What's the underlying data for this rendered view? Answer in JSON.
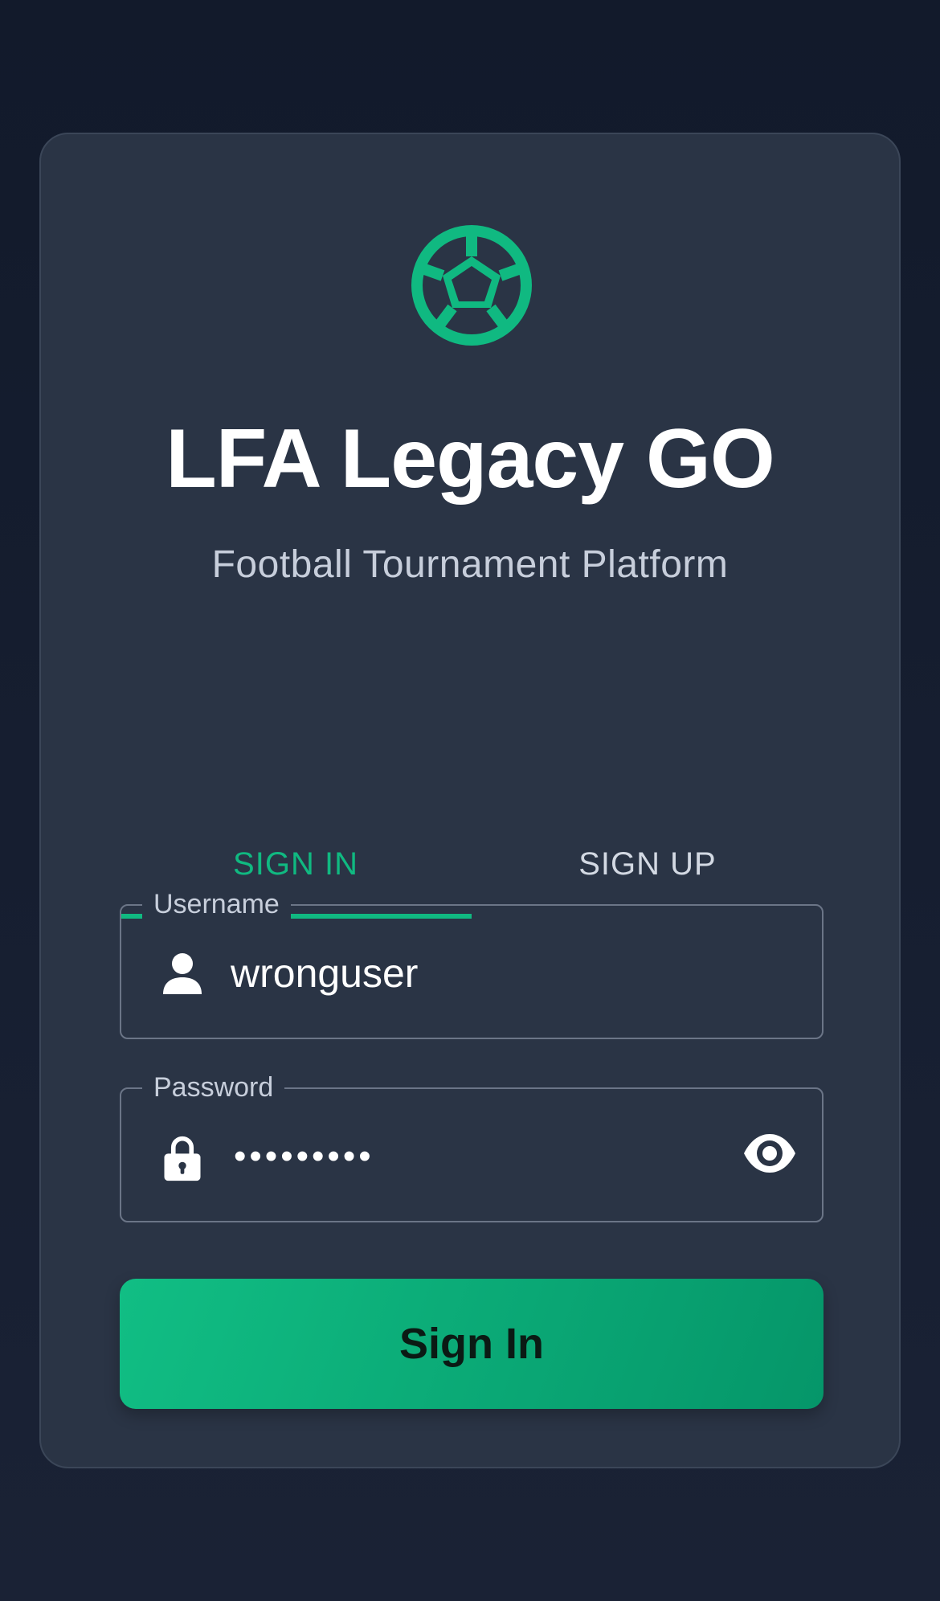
{
  "app": {
    "title": "LFA Legacy GO",
    "subtitle": "Football Tournament Platform",
    "logo_icon": "soccer-ball-icon"
  },
  "colors": {
    "accent": "#10b981",
    "card_bg": "#2a3445",
    "page_bg": "#121a2b"
  },
  "tabs": [
    {
      "label": "SIGN IN",
      "active": true
    },
    {
      "label": "SIGN UP",
      "active": false
    }
  ],
  "form": {
    "username": {
      "label": "Username",
      "value": "wronguser",
      "icon": "person-icon"
    },
    "password": {
      "label": "Password",
      "masked_value": "•••••••••",
      "icon": "lock-icon",
      "toggle_icon": "eye-icon"
    },
    "submit_label": "Sign In"
  }
}
